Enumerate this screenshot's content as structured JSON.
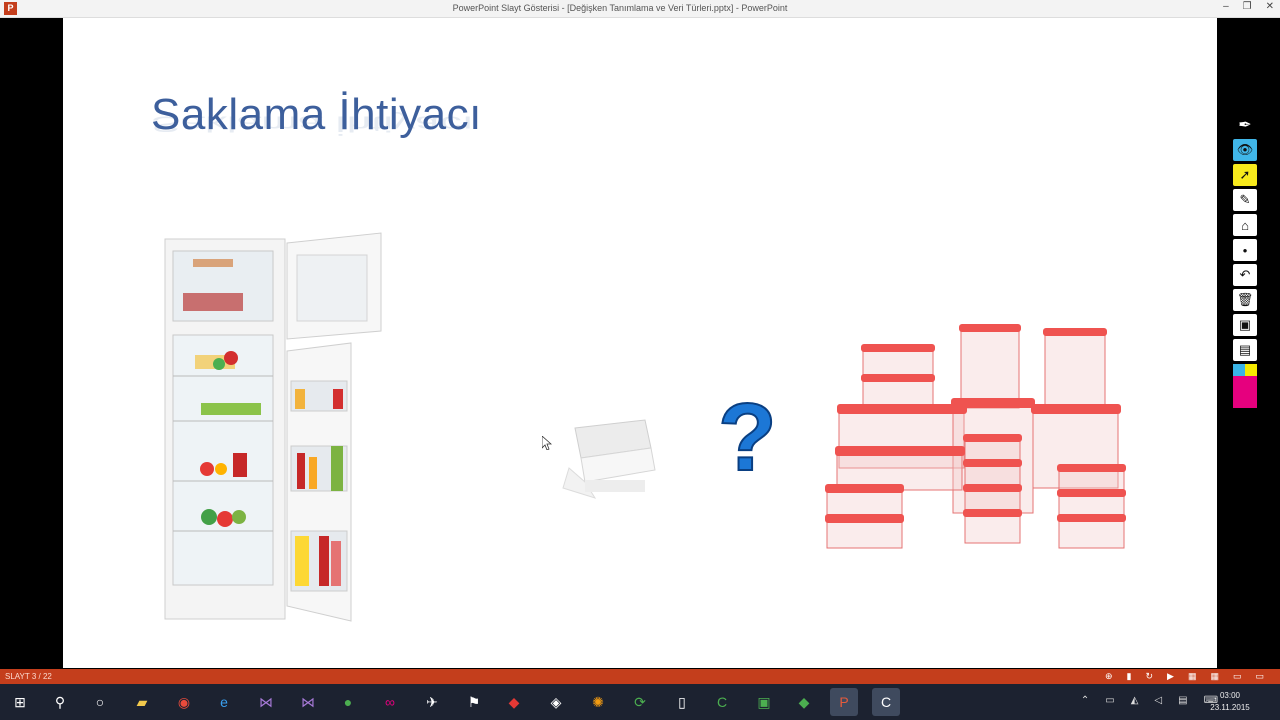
{
  "window": {
    "title": "PowerPoint Slayt Gösterisi - [Değişken Tanımlama ve Veri Türleri.pptx] - PowerPoint",
    "app_icon": "P",
    "controls": {
      "minimize": "–",
      "restore": "❐",
      "close": "✕"
    }
  },
  "slide": {
    "title": "Saklama İhtiyacı",
    "question_mark": "?",
    "images": [
      "refrigerator",
      "plastic-food-tray",
      "food-storage-containers"
    ]
  },
  "ink_tools": {
    "items": [
      "pen-icon",
      "eye-icon",
      "selection-arrow-icon",
      "eraser-icon",
      "tag-icon",
      "dot-size-icon",
      "undo-icon",
      "trash-icon",
      "camera-icon",
      "document-icon"
    ],
    "colors": [
      "#3ab4e6",
      "#f5ea00",
      "#e6007e"
    ]
  },
  "statusbar": {
    "slide_counter": "SLAYT 3 / 22",
    "accent": "#c43e1c"
  },
  "taskbar": {
    "clock_time": "03:00",
    "clock_date": "23.11.2015"
  }
}
